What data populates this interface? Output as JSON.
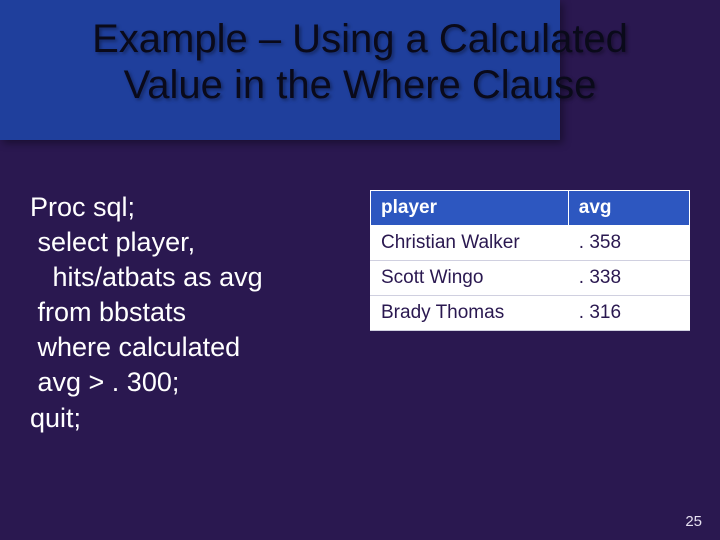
{
  "slide": {
    "title": "Example – Using a Calculated Value in the Where Clause",
    "page_number": "25"
  },
  "code": {
    "l1": "Proc sql;",
    "l2": " select player,",
    "l3": "   hits/atbats as avg",
    "l4": " from bbstats",
    "l5": " where calculated",
    "l6": " avg > . 300;",
    "l7": "quit;"
  },
  "table": {
    "headers": {
      "c1": "player",
      "c2": "avg"
    },
    "rows": [
      {
        "c1": "Christian Walker",
        "c2": ". 358"
      },
      {
        "c1": "Scott Wingo",
        "c2": ". 338"
      },
      {
        "c1": "Brady Thomas",
        "c2": ". 316"
      }
    ]
  }
}
